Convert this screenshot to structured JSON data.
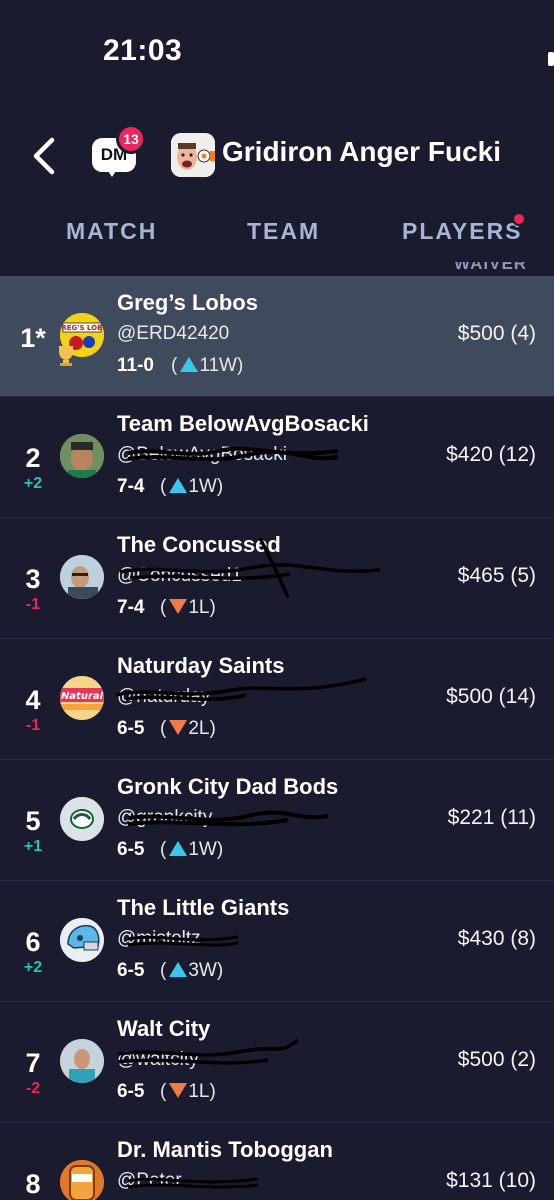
{
  "status": {
    "time": "21:03"
  },
  "nav": {
    "dm_label": "DM",
    "dm_count": "13",
    "league_title": "Gridiron Anger Fucki"
  },
  "tabs": [
    {
      "label": "MATCH"
    },
    {
      "label": "TEAM"
    },
    {
      "label": "PLAYERS",
      "has_notification": true
    }
  ],
  "column_header": "WAIVER",
  "colors": {
    "background": "#1a1b2e",
    "highlight_row": "#404a5d",
    "badge": "#e8275a",
    "rank_up": "#27c4a8",
    "rank_down": "#e8275a",
    "streak_up": "#3bc7e8",
    "streak_down": "#f07a4a",
    "tab_text": "#a9b4d4"
  },
  "standings": [
    {
      "rank": "1*",
      "change": "",
      "name": "Greg’s Lobos",
      "handle": "@ERD42420",
      "record": "11-0",
      "streak": "11W",
      "streak_dir": "up",
      "waiver": "$500 (4)",
      "highlight": true
    },
    {
      "rank": "2",
      "change": "+2",
      "name": "Team BelowAvgBosacki",
      "handle": "@BelowAvgBosacki",
      "record": "7-4",
      "streak": "1W",
      "streak_dir": "up",
      "waiver": "$420 (12)"
    },
    {
      "rank": "3",
      "change": "-1",
      "name": "The Concussed",
      "handle": "@Concussed1",
      "record": "7-4",
      "streak": "1L",
      "streak_dir": "down",
      "waiver": "$465 (5)"
    },
    {
      "rank": "4",
      "change": "-1",
      "name": "Naturday Saints",
      "handle": "@naturday",
      "record": "6-5",
      "streak": "2L",
      "streak_dir": "down",
      "waiver": "$500 (14)"
    },
    {
      "rank": "5",
      "change": "+1",
      "name": "Gronk City Dad Bods",
      "handle": "@gronkcity",
      "record": "6-5",
      "streak": "1W",
      "streak_dir": "up",
      "waiver": "$221 (11)"
    },
    {
      "rank": "6",
      "change": "+2",
      "name": "The Little Giants",
      "handle": "@mistoltz",
      "record": "6-5",
      "streak": "3W",
      "streak_dir": "up",
      "waiver": "$430 (8)"
    },
    {
      "rank": "7",
      "change": "-2",
      "name": "Walt City",
      "handle": "@waltcity",
      "record": "6-5",
      "streak": "1L",
      "streak_dir": "down",
      "waiver": "$500 (2)"
    },
    {
      "rank": "8",
      "change": "",
      "name": "Dr. Mantis Toboggan",
      "handle": "@Peter",
      "record": "",
      "streak": "",
      "streak_dir": "",
      "waiver": "$131 (10)"
    }
  ]
}
